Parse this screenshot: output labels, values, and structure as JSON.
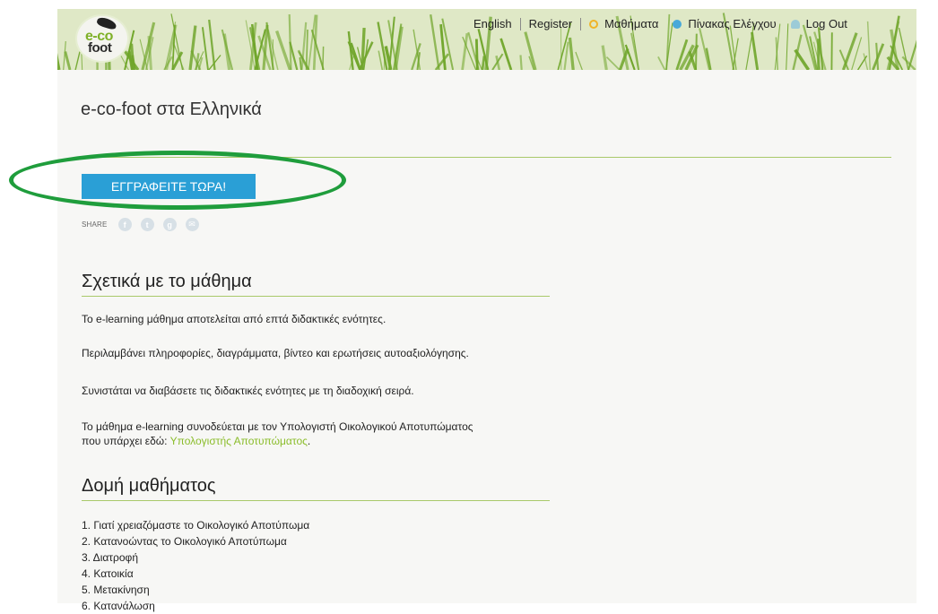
{
  "logo": {
    "line1": "e-co",
    "line2": "foot"
  },
  "nav": {
    "english": "English",
    "register": "Register",
    "courses": "Μαθήματα",
    "dashboard": "Πίνακας Ελέγχου",
    "logout": "Log Out"
  },
  "icons": {
    "courses": "search-icon",
    "dashboard": "dashboard-icon",
    "logout": "user-icon"
  },
  "course": {
    "title": "e-co-foot στα Ελληνικά",
    "enroll_label": "ΕΓΓΡΑΦΕΙΤΕ ΤΩΡΑ!",
    "share_label": "SHARE"
  },
  "social": [
    "facebook-icon",
    "twitter-icon",
    "googleplus-icon",
    "email-icon"
  ],
  "about": {
    "heading": "Σχετικά με το μάθημα",
    "p1": "Το e-learning μάθημα αποτελείται από επτά διδακτικές ενότητες.",
    "p2": "Περιλαμβάνει πληροφορίες, διαγράμματα, βίντεο και ερωτήσεις αυτοαξιολόγησης.",
    "p3": "Συνιστάται να διαβάσετε τις διδακτικές ενότητες με τη διαδοχική σειρά.",
    "p4_line1": "Το μάθημα e-learning συνοδεύεται με τον Υπολογιστή Οικολογικού Αποτυπώματος",
    "p4_line2_prefix": "που υπάρχει εδώ: ",
    "p4_link": "Υπολογιστής Αποτυπώματος",
    "p4_suffix": "."
  },
  "structure": {
    "heading": "Δομή μαθήματος",
    "items": [
      "1. Γιατί χρειαζόμαστε το Οικολογικό Αποτύπωμα",
      "2. Κατανοώντας το Οικολογικό Αποτύπωμα",
      "3. Διατροφή",
      "4. Κατοικία",
      "5. Μετακίνηση",
      "6. Κατανάλωση"
    ]
  },
  "colors": {
    "accent_green": "#8bbd2b",
    "button_blue": "#2a9fd6",
    "highlight_oval": "#1f9d3c"
  }
}
